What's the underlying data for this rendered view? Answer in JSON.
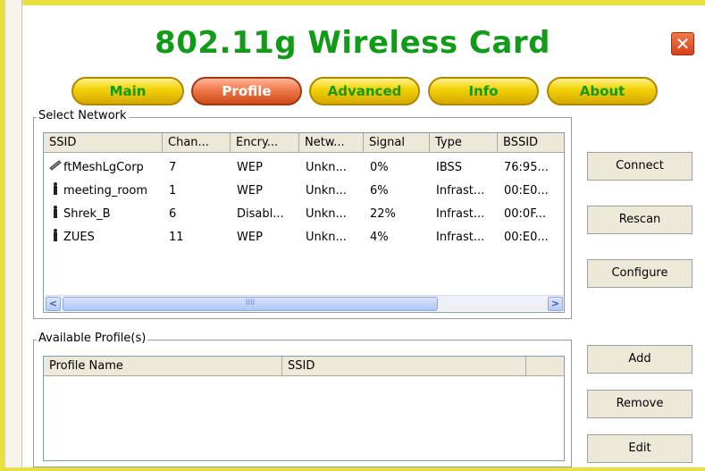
{
  "app": {
    "title": "802.11g Wireless Card",
    "close_glyph": "✕"
  },
  "tabs": [
    {
      "label": "Main",
      "active": false
    },
    {
      "label": "Profile",
      "active": true
    },
    {
      "label": "Advanced",
      "active": false
    },
    {
      "label": "Info",
      "active": false
    },
    {
      "label": "About",
      "active": false
    }
  ],
  "select_network": {
    "label": "Select Network",
    "columns": [
      "SSID",
      "Chan...",
      "Encry...",
      "Netw...",
      "Signal",
      "Type",
      "BSSID"
    ],
    "rows": [
      {
        "icon": "adhoc-network-icon",
        "ssid": "ftMeshLgCorp",
        "channel": "7",
        "encryption": "WEP",
        "network": "Unkn...",
        "signal": "0%",
        "type": "IBSS",
        "bssid": "76:95..."
      },
      {
        "icon": "access-point-icon",
        "ssid": "meeting_room",
        "channel": "1",
        "encryption": "WEP",
        "network": "Unkn...",
        "signal": "6%",
        "type": "Infrast...",
        "bssid": "00:E0..."
      },
      {
        "icon": "access-point-icon",
        "ssid": "Shrek_B",
        "channel": "6",
        "encryption": "Disabl...",
        "network": "Unkn...",
        "signal": "22%",
        "type": "Infrast...",
        "bssid": "00:0F..."
      },
      {
        "icon": "access-point-icon",
        "ssid": "ZUES",
        "channel": "11",
        "encryption": "WEP",
        "network": "Unkn...",
        "signal": "4%",
        "type": "Infrast...",
        "bssid": "00:E0..."
      }
    ],
    "scroll": {
      "left_glyph": "<",
      "right_glyph": ">",
      "thumb_grip": "IIII"
    }
  },
  "network_buttons": {
    "connect": "Connect",
    "rescan": "Rescan",
    "configure": "Configure"
  },
  "available_profiles": {
    "label": "Available Profile(s)",
    "columns": [
      "Profile Name",
      "SSID",
      ""
    ]
  },
  "profile_buttons": {
    "add": "Add",
    "remove": "Remove",
    "edit": "Edit"
  },
  "colors": {
    "accent_green": "#119b19",
    "tab_yellow": "#f3d40a",
    "tab_active": "#f07a4a",
    "close_red": "#d8401c",
    "frame_yellow": "#e8e040"
  }
}
